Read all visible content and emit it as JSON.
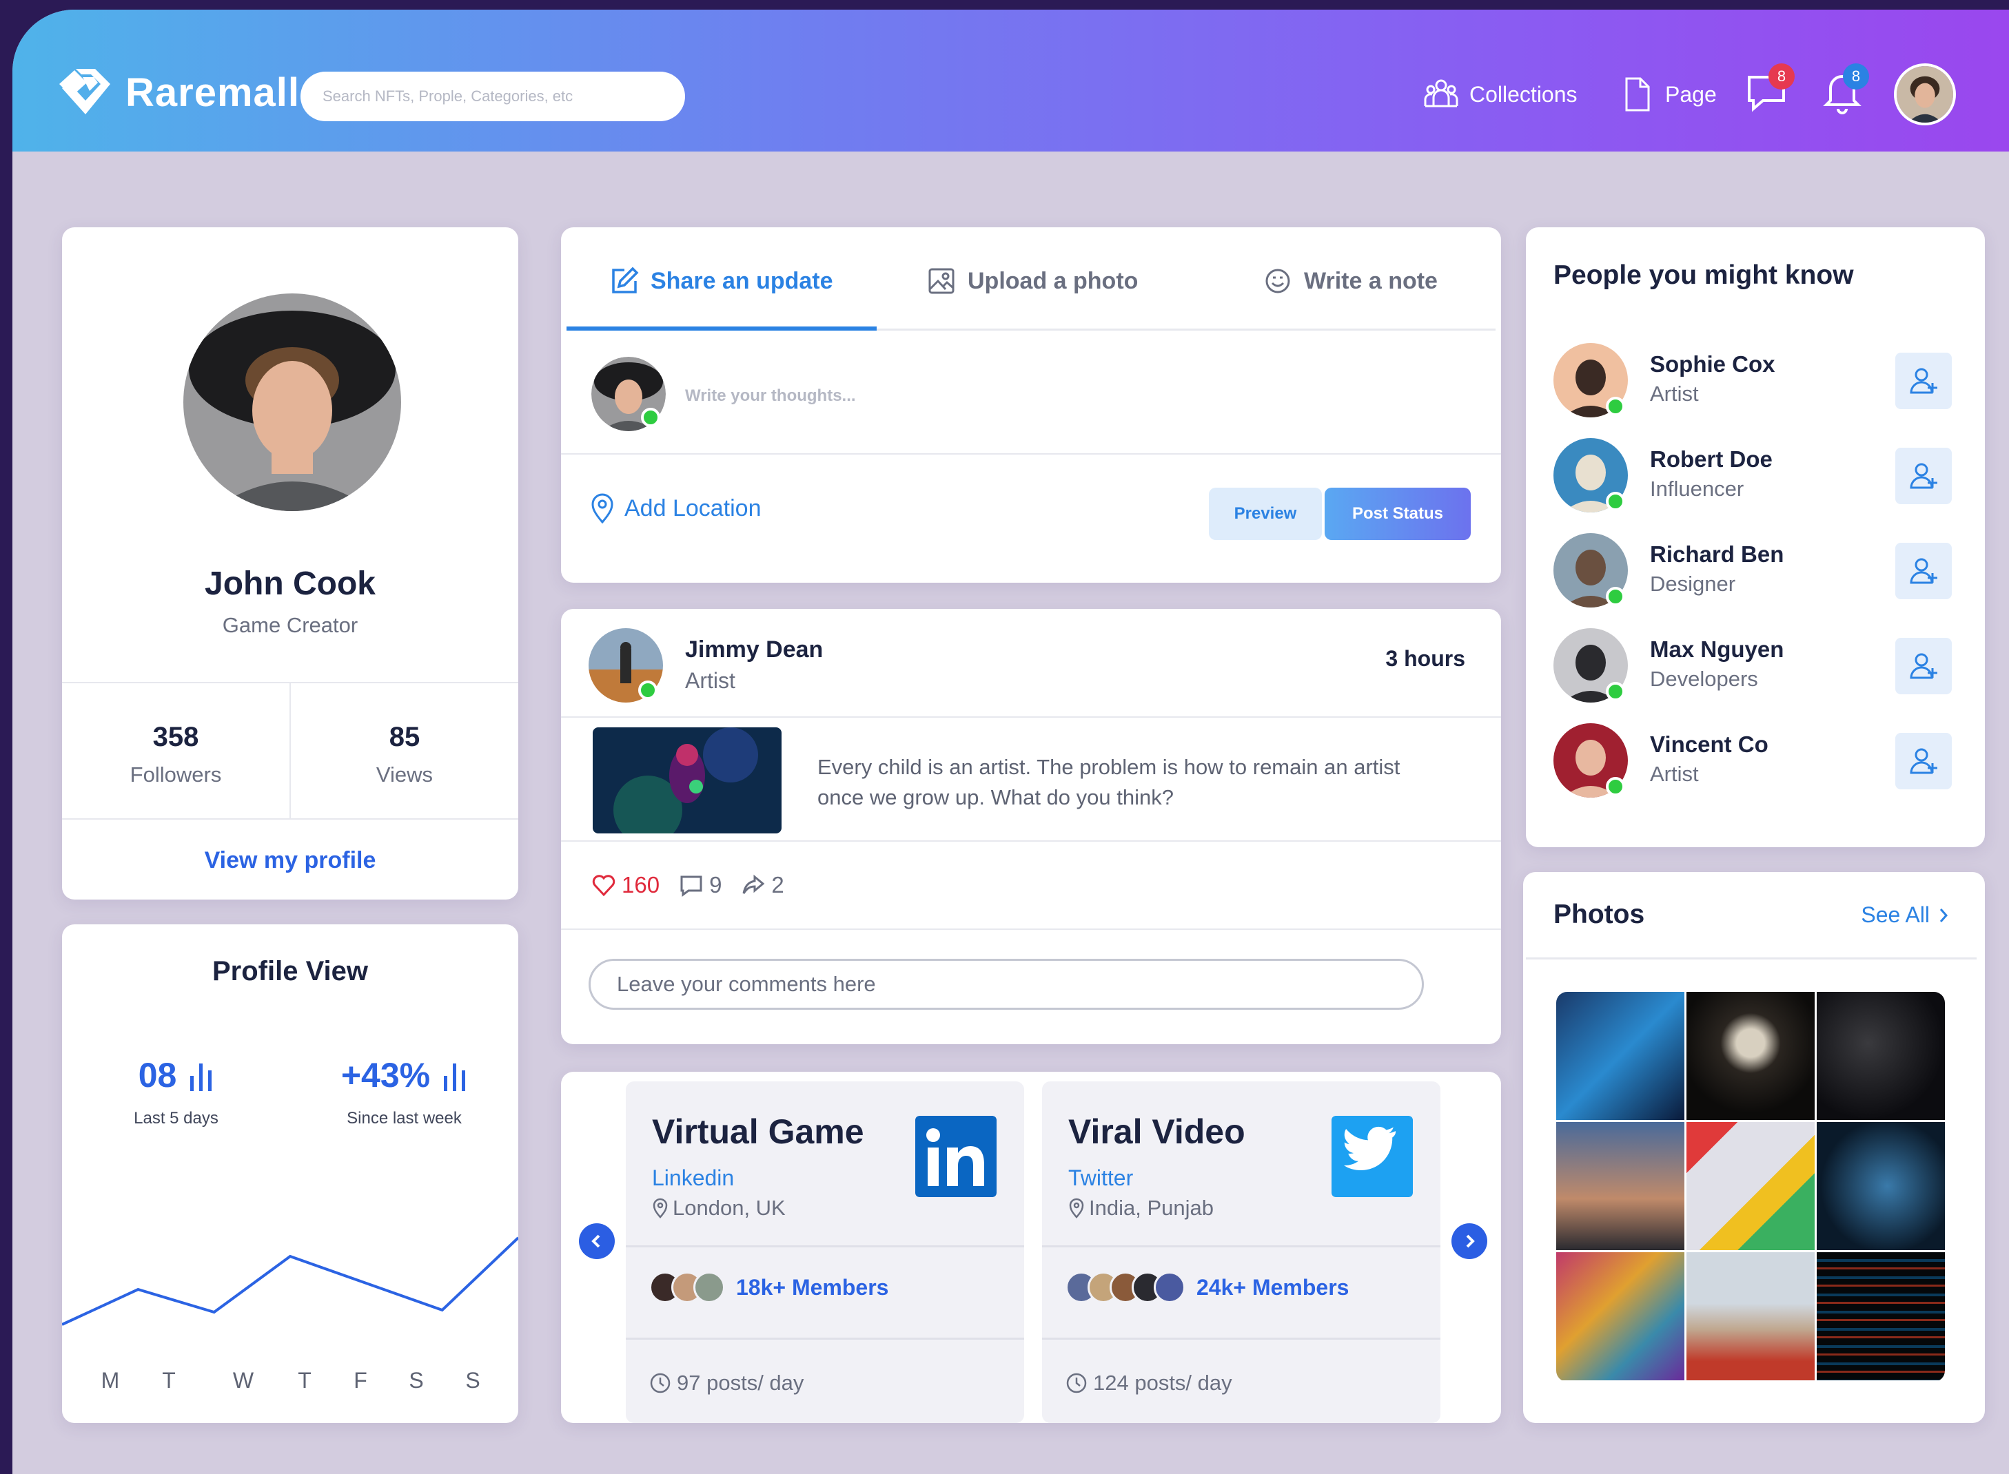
{
  "app": {
    "name": "Raremall"
  },
  "header": {
    "search_placeholder": "Search NFTs, Prople, Categories, etc",
    "nav": {
      "collections": "Collections",
      "page": "Page"
    },
    "messages_badge": "8",
    "notifications_badge": "8"
  },
  "profile": {
    "name": "John Cook",
    "role": "Game Creator",
    "followers": "358",
    "followers_label": "Followers",
    "views": "85",
    "views_label": "Views",
    "view_profile": "View my profile"
  },
  "profile_view": {
    "title": "Profile View",
    "metric1_value": "08",
    "metric1_label": "Last 5 days",
    "metric2_value": "+43%",
    "metric2_label": "Since last week",
    "chart_data": {
      "type": "line",
      "categories": [
        "M",
        "T",
        "W",
        "T",
        "F",
        "S",
        "S"
      ],
      "values": [
        2.3,
        4.0,
        2.9,
        5.6,
        4.3,
        3.0,
        6.5
      ],
      "ylim": [
        0,
        10
      ],
      "grid": false,
      "title": ""
    }
  },
  "composer": {
    "tabs": [
      {
        "label": "Share an update"
      },
      {
        "label": "Upload a photo"
      },
      {
        "label": "Write a note"
      }
    ],
    "placeholder": "Write your thoughts...",
    "add_location": "Add Location",
    "preview": "Preview",
    "post_status": "Post Status"
  },
  "post": {
    "author": "Jimmy Dean",
    "role": "Artist",
    "time": "3 hours",
    "text": "Every child is an artist. The problem is how to remain an artist once we grow up. What do you think?",
    "likes": "160",
    "comments": "9",
    "shares": "2",
    "comment_placeholder": "Leave your comments here"
  },
  "groups": [
    {
      "title": "Virtual Game",
      "network": "Linkedin",
      "location": "London, UK",
      "members": "18k+ Members",
      "posts": "97 posts/ day",
      "brand_color": "#0a66c2"
    },
    {
      "title": "Viral Video",
      "network": "Twitter",
      "location": "India, Punjab",
      "members": "24k+ Members",
      "posts": "124 posts/ day",
      "brand_color": "#1da1f2"
    }
  ],
  "people": {
    "title": "People you might know",
    "items": [
      {
        "name": "Sophie Cox",
        "role": "Artist"
      },
      {
        "name": "Robert Doe",
        "role": "Influencer"
      },
      {
        "name": "Richard Ben",
        "role": "Designer"
      },
      {
        "name": "Max Nguyen",
        "role": "Developers"
      },
      {
        "name": "Vincent Co",
        "role": "Artist"
      }
    ]
  },
  "photos": {
    "title": "Photos",
    "see_all": "See All"
  },
  "colors": {
    "accent": "#2b82e3",
    "primary_blue": "#2b63e3",
    "like_red": "#e02a3c",
    "online_green": "#2ecc40"
  }
}
